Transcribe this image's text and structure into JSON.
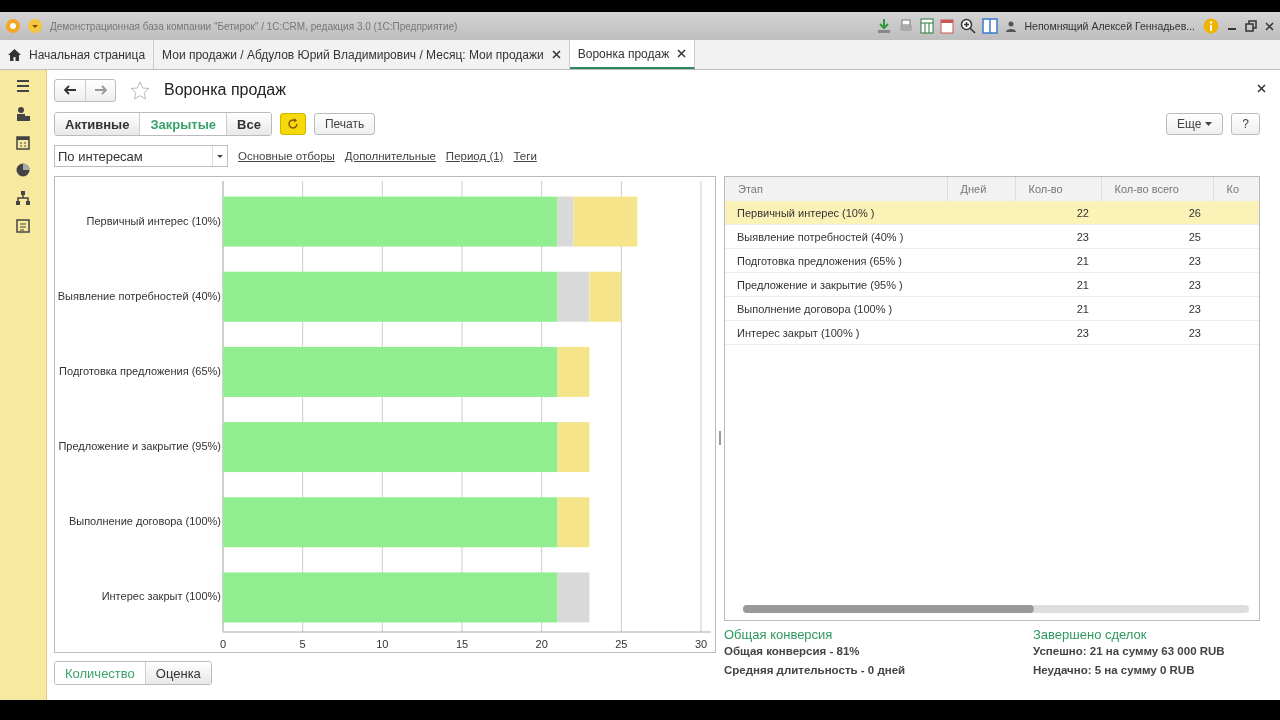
{
  "window": {
    "title": "Демонстрационная база компании \"Бетирок\" / 1С:CRM, редакция 3.0 (1С:Предприятие)",
    "user": "Непомнящий Алексей Геннадьев..."
  },
  "tabs": [
    {
      "label": "Начальная страница",
      "kind": "home",
      "selected": false
    },
    {
      "label": "Мои продажи / Абдулов Юрий Владимирович / Месяц: Мои продажи",
      "kind": "document",
      "selected": false
    },
    {
      "label": "Воронка продаж",
      "kind": "document",
      "selected": true
    }
  ],
  "form": {
    "title": "Воронка продаж",
    "filter_buttons": [
      {
        "label": "Активные",
        "selected": false
      },
      {
        "label": "Закрытые",
        "selected": true
      },
      {
        "label": "Все",
        "selected": false
      }
    ],
    "print_button": "Печать",
    "more_button": "Еще",
    "help_button": "?",
    "grouping": {
      "value": "По интересам"
    },
    "links": [
      "Основные отборы",
      "Дополнительные",
      "Период (1)",
      "Теги"
    ],
    "chart": {
      "chart_data": {
        "type": "bar",
        "orientation": "horizontal",
        "stacked": true,
        "categories": [
          "Первичный интерес (10%)",
          "Выявление потребностей (40%)",
          "Подготовка предложения (65%)",
          "Предложение и закрытие (95%)",
          "Выполнение договора (100%)",
          "Интерес закрыт (100%)"
        ],
        "series": [
          {
            "color": "#90ee90",
            "values": [
              21,
              21,
              21,
              21,
              21,
              21
            ]
          },
          {
            "color": "#d9d9d9",
            "values": [
              1,
              2,
              0,
              0,
              0,
              2
            ]
          },
          {
            "color": "#f5e48a",
            "values": [
              4,
              2,
              2,
              2,
              2,
              0
            ]
          }
        ],
        "xlim": [
          0,
          30
        ],
        "grid": true,
        "xticks": [
          0,
          5,
          10,
          15,
          20,
          25,
          30
        ]
      }
    },
    "view_toggle": [
      {
        "label": "Количество",
        "selected": true
      },
      {
        "label": "Оценка",
        "selected": false
      }
    ],
    "table": {
      "columns": [
        "Этап",
        "Дней",
        "Кол-во",
        "Кол-во всего",
        "Ко"
      ],
      "rows": [
        {
          "cells": [
            "Первичный интерес (10% )",
            "",
            "22",
            "26",
            ""
          ],
          "selected": true
        },
        {
          "cells": [
            "Выявление потребностей (40% )",
            "",
            "23",
            "25",
            ""
          ],
          "selected": false
        },
        {
          "cells": [
            "Подготовка предложения (65% )",
            "",
            "21",
            "23",
            ""
          ],
          "selected": false
        },
        {
          "cells": [
            "Предложение и закрытие (95% )",
            "",
            "21",
            "23",
            ""
          ],
          "selected": false
        },
        {
          "cells": [
            "Выполнение договора (100% )",
            "",
            "21",
            "23",
            ""
          ],
          "selected": false
        },
        {
          "cells": [
            "Интерес закрыт (100% )",
            "",
            "23",
            "23",
            ""
          ],
          "selected": false
        }
      ]
    },
    "summary": [
      {
        "heading": "Общая конверсия",
        "lines": [
          "Общая конверсия - 81%",
          "Средняя длительность - 0 дней"
        ]
      },
      {
        "heading": "Завершено сделок",
        "lines": [
          "Успешно: 21 на сумму 63 000 RUB",
          "Неудачно: 5 на сумму 0 RUB"
        ]
      }
    ]
  }
}
